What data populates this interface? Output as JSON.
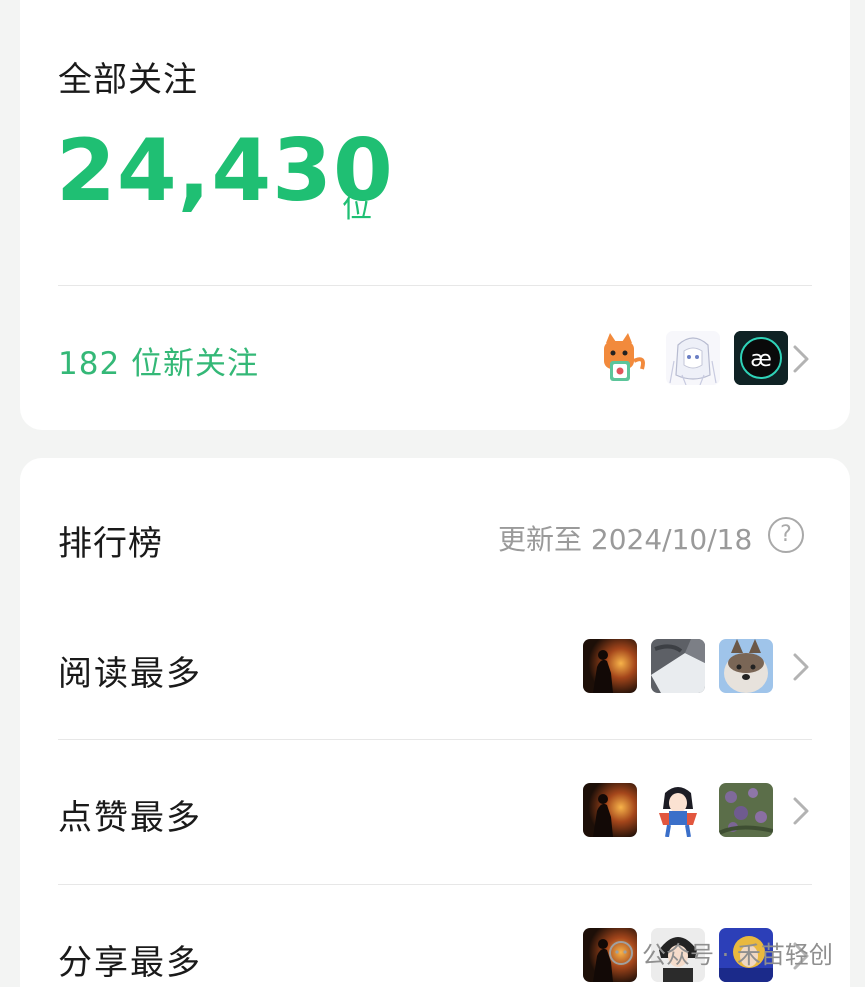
{
  "following": {
    "title": "全部关注",
    "count": "24,430",
    "unit": "位",
    "new_followers": "182 位新关注",
    "avatars": [
      "cat-sticker-avatar",
      "anime-sketch-avatar",
      "ae-logo-avatar"
    ]
  },
  "ranking": {
    "title": "排行榜",
    "updated": "更新至 2024/10/18",
    "help": "?",
    "rows": [
      {
        "label": "阅读最多",
        "thumbs": [
          "sunset-silhouette-thumb",
          "paper-sheet-thumb",
          "husky-dog-thumb"
        ]
      },
      {
        "label": "点赞最多",
        "thumbs": [
          "sunset-silhouette-thumb",
          "anime-girl-thumb",
          "purple-flowers-thumb"
        ]
      },
      {
        "label": "分享最多",
        "thumbs": [
          "sunset-silhouette-thumb",
          "anime-boy-thumb",
          "blue-yellow-thumb"
        ]
      }
    ]
  },
  "watermark": {
    "text": "公众号 · 禾苗轻创"
  },
  "colors": {
    "accent": "#1fbf73",
    "accent_text": "#34b877",
    "muted": "#9a9a9a"
  }
}
